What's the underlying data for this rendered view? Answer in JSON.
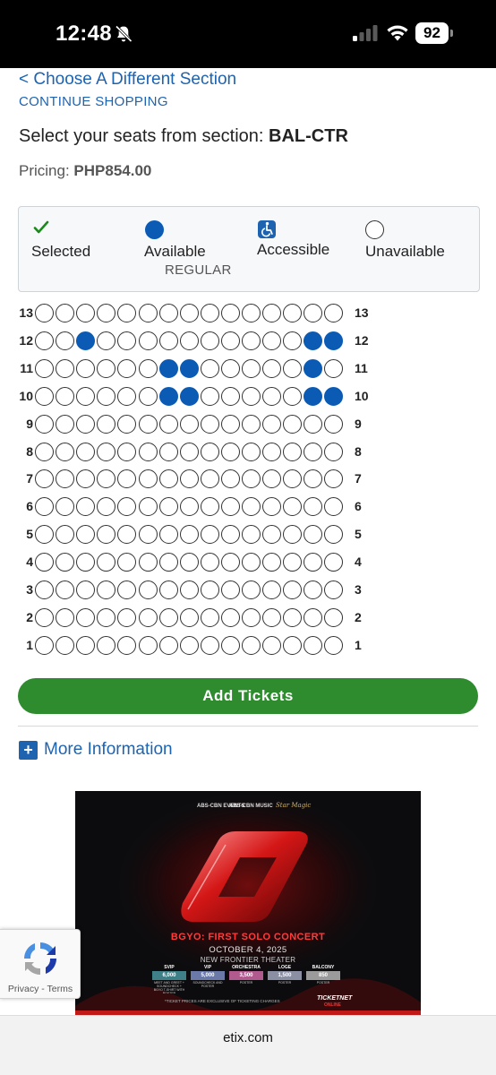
{
  "status_bar": {
    "time": "12:48",
    "battery": "92",
    "icons": [
      "bell-off-icon",
      "signal-icon",
      "wifi-icon",
      "battery-icon"
    ]
  },
  "nav": {
    "back_link": "< Choose A Different Section",
    "continue_link": "CONTINUE SHOPPING"
  },
  "section": {
    "prompt": "Select your seats from section: ",
    "name": "BAL-CTR"
  },
  "pricing": {
    "label": "Pricing: ",
    "value": "PHP854.00"
  },
  "legend": {
    "selected": "Selected",
    "available": "Available",
    "available_sub": "REGULAR",
    "accessible": "Accessible",
    "unavailable": "Unavailable",
    "colors": {
      "selected": "#1a8a1a",
      "available": "#0b5bb5",
      "accessible": "#1e63b0"
    }
  },
  "seatmap": {
    "seats_per_row": 15,
    "rows": [
      {
        "label": "13",
        "available": []
      },
      {
        "label": "12",
        "available": [
          3,
          14,
          15
        ]
      },
      {
        "label": "11",
        "available": [
          7,
          8,
          14
        ]
      },
      {
        "label": "10",
        "available": [
          7,
          8,
          14,
          15
        ]
      },
      {
        "label": "9",
        "available": []
      },
      {
        "label": "8",
        "available": []
      },
      {
        "label": "7",
        "available": []
      },
      {
        "label": "6",
        "available": []
      },
      {
        "label": "5",
        "available": []
      },
      {
        "label": "4",
        "available": []
      },
      {
        "label": "3",
        "available": []
      },
      {
        "label": "2",
        "available": []
      },
      {
        "label": "1",
        "available": []
      }
    ]
  },
  "actions": {
    "add_tickets": "Add Tickets",
    "more_information": "More Information"
  },
  "poster": {
    "logos": [
      "ABS-CBN EVENTS",
      "ABS-CBN MUSIC",
      "Star Magic"
    ],
    "title": "BGYO: FIRST SOLO CONCERT",
    "date": "OCTOBER 4, 2025",
    "venue": "NEW FRONTIER THEATER",
    "tiers": [
      {
        "name": "SVIP",
        "price": "6,000",
        "note": "MEET AND GREET + SOUNDCHECK + BGYO T-SHIRT WITH POSTER",
        "color": "#3f7f88"
      },
      {
        "name": "VIP",
        "price": "5,000",
        "note": "SOUNDCHECK AND POSTER",
        "color": "#6b79a8"
      },
      {
        "name": "ORCHESTRA",
        "price": "3,500",
        "note": "POSTER",
        "color": "#b05a8e"
      },
      {
        "name": "LOGE",
        "price": "1,500",
        "note": "POSTER",
        "color": "#8a8fa4"
      },
      {
        "name": "BALCONY",
        "price": "850",
        "note": "POSTER",
        "color": "#9b9b9b"
      }
    ],
    "disclaimer": "*TICKET PRICES ARE EXCLUSIVE OF TICKETING CHARGES",
    "ticketnet": "TICKETNET",
    "ticketnet_sub": "ONLINE"
  },
  "recaptcha": {
    "links": "Privacy - Terms"
  },
  "browser": {
    "url": "etix.com"
  }
}
